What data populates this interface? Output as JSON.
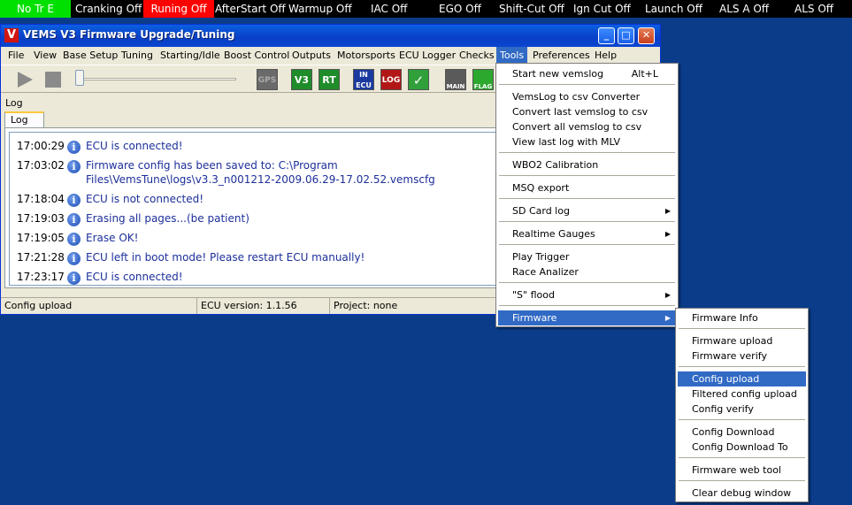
{
  "status_indicators": [
    {
      "label": "No Tr E",
      "bg": "#00e000"
    },
    {
      "label": "Cranking Off",
      "bg": ""
    },
    {
      "label": "Runing Off",
      "bg": "#ff0000"
    },
    {
      "label": "AfterStart Off",
      "bg": ""
    },
    {
      "label": "Warmup Off",
      "bg": ""
    },
    {
      "label": "IAC Off",
      "bg": ""
    },
    {
      "label": "EGO Off",
      "bg": ""
    },
    {
      "label": "Shift-Cut Off",
      "bg": ""
    },
    {
      "label": "Ign Cut Off",
      "bg": ""
    },
    {
      "label": "Launch Off",
      "bg": ""
    },
    {
      "label": "ALS A Off",
      "bg": ""
    },
    {
      "label": "ALS Off",
      "bg": ""
    }
  ],
  "window": {
    "title": "VEMS V3 Firmware Upgrade/Tuning",
    "icon_letter": "V"
  },
  "menubar": [
    "File",
    "View",
    "Base Setup",
    "Tuning",
    "Starting/Idle",
    "Boost Control",
    "Outputs",
    "Motorsports",
    "ECU Logger",
    "Checks",
    "Tools",
    "Preferences",
    "Help"
  ],
  "toolbar": {
    "icons": [
      {
        "name": "play-icon"
      },
      {
        "name": "stop-icon"
      },
      {
        "name": "gps-icon",
        "label": "GPS"
      },
      {
        "name": "v3-icon",
        "label": "V3"
      },
      {
        "name": "rt-icon",
        "label": "RT"
      },
      {
        "name": "in-ecu-icon",
        "label": "IN ECU"
      },
      {
        "name": "log-icon",
        "label": "LOG"
      },
      {
        "name": "check-icon",
        "label": "✓"
      },
      {
        "name": "main-icon",
        "label": "MAIN"
      },
      {
        "name": "flag-icon",
        "label": "FLAG"
      }
    ]
  },
  "log": {
    "label": "Log",
    "tab": "Log",
    "entries": [
      {
        "time": "17:00:29",
        "msg": "ECU is connected!"
      },
      {
        "time": "17:03:02",
        "msg": "Firmware config has been saved to: C:\\Program",
        "msg2": "Files\\VemsTune\\logs\\v3.3_n001212-2009.06.29-17.02.52.vemscfg"
      },
      {
        "time": "17:18:04",
        "msg": "ECU is not connected!"
      },
      {
        "time": "17:19:03",
        "msg": "Erasing all pages...(be patient)"
      },
      {
        "time": "17:19:05",
        "msg": "Erase OK!"
      },
      {
        "time": "17:21:28",
        "msg": "ECU left in boot mode! Please restart ECU manually!"
      },
      {
        "time": "17:23:17",
        "msg": "ECU is connected!"
      }
    ]
  },
  "winstatus": {
    "action": "Config upload",
    "ecu_version": "ECU version: 1.1.56",
    "project": "Project: none"
  },
  "tools_menu": {
    "items": [
      {
        "label": "Start new vemslog",
        "shortcut": "Alt+L"
      },
      {
        "label": "VemsLog to csv Converter"
      },
      {
        "label": "Convert last vemslog to csv"
      },
      {
        "label": "Convert all vemslog to csv"
      },
      {
        "label": "View last log with MLV"
      },
      {
        "label": "WBO2 Calibration"
      },
      {
        "label": "MSQ export"
      },
      {
        "label": "SD Card log"
      },
      {
        "label": "Realtime Gauges"
      },
      {
        "label": "Play Trigger"
      },
      {
        "label": "Race Analizer"
      },
      {
        "label": "\"S\" flood"
      },
      {
        "label": "Firmware"
      }
    ]
  },
  "firmware_menu": {
    "items": [
      {
        "label": "Firmware Info"
      },
      {
        "label": "Firmware upload"
      },
      {
        "label": "Firmware verify"
      },
      {
        "label": "Config upload"
      },
      {
        "label": "Filtered config upload"
      },
      {
        "label": "Config verify"
      },
      {
        "label": "Config Download"
      },
      {
        "label": "Config Download To"
      },
      {
        "label": "Firmware web tool"
      },
      {
        "label": "Clear debug window"
      }
    ]
  }
}
